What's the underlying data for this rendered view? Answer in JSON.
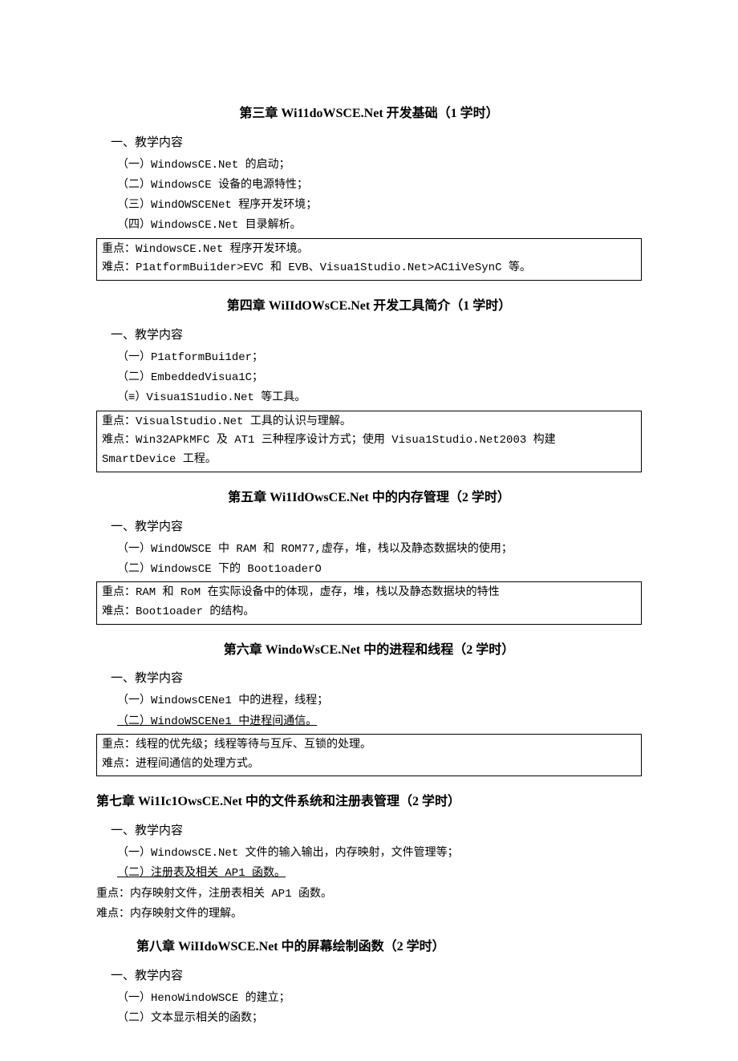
{
  "ch3": {
    "title_pre": "第三章 ",
    "title_kw": "Wi11doWSCE.Net",
    "title_post": " 开发基础（1 学时）",
    "section": "一、教学内容",
    "items": [
      "（一）WindowsCE.Net 的启动；",
      "（二）WindowsCE 设备的电源特性；",
      "（三）WindOWSCENet 程序开发环境；",
      "（四）WindowsCE.Net 目录解析。"
    ],
    "box": [
      "重点：WindowsCE.Net 程序开发环境。",
      "难点：P1atformBui1der>EVC 和 EVB、Visua1Studio.Net>AC1iVeSynC 等。"
    ]
  },
  "ch4": {
    "title_pre": "第四章 ",
    "title_kw": "WiIIdOWsCE.Net",
    "title_post": " 开发工具简介（1 学时）",
    "section": "一、教学内容",
    "items": [
      "（一）P1atformBui1der；",
      "（二）EmbeddedVisua1C；",
      "（≡）Visua1S1udio.Net 等工具。"
    ],
    "box": [
      "重点：VisualStudio.Net 工具的认识与理解。",
      "难点：Win32APkMFC 及 AT1 三种程序设计方式；使用 Visua1Studio.Net2003 构建 SmartDevice 工程。"
    ]
  },
  "ch5": {
    "title_pre": "第五章 ",
    "title_kw": "Wi1IdOwsCE.Net",
    "title_post": " 中的内存管理（2 学时）",
    "section": "一、教学内容",
    "items": [
      "（一）WindOWSCE 中 RAM 和 ROM77,虚存，堆，栈以及静态数据块的使用；",
      "（二）WindowsCE 下的 Boot1oaderO"
    ],
    "box": [
      "重点：RAM 和 RoM 在实际设备中的体现，虚存，堆，栈以及静态数据块的特性",
      "难点：Boot1oader 的结构。"
    ]
  },
  "ch6": {
    "title_pre": "第六章 ",
    "title_kw": "WindoWsCE.Net",
    "title_post": " 中的进程和线程（2 学时）",
    "section": "一、教学内容",
    "items": [
      "（一）WindowsCENe1 中的进程，线程；"
    ],
    "item_underline": "（二）WindoWSCENe1 中进程间通信。",
    "box": [
      "重点：线程的优先级；线程等待与互斥、互锁的处理。",
      "难点：进程间通信的处理方式。"
    ]
  },
  "ch7": {
    "title_pre": "第七章 ",
    "title_kw": "Wi1Ic1OwsCE.Net",
    "title_post": " 中的文件系统和注册表管理（2 学时）",
    "section": "一、教学内容",
    "items": [
      "（一）WindowsCE.Net 文件的输入输出，内存映射，文件管理等；"
    ],
    "item_underline": "（二）注册表及相关 AP1 函数。",
    "notes": [
      "重点：内存映射文件，注册表相关 AP1 函数。",
      "难点：内存映射文件的理解。"
    ]
  },
  "ch8": {
    "title_pre": "第八章 ",
    "title_kw": "WiIIdoWSCE.Net",
    "title_post": " 中的屏幕绘制函数（2 学时）",
    "section": "一、教学内容",
    "items": [
      "（一）HenoWindoWSCE 的建立；",
      "（二）文本显示相关的函数；"
    ]
  }
}
